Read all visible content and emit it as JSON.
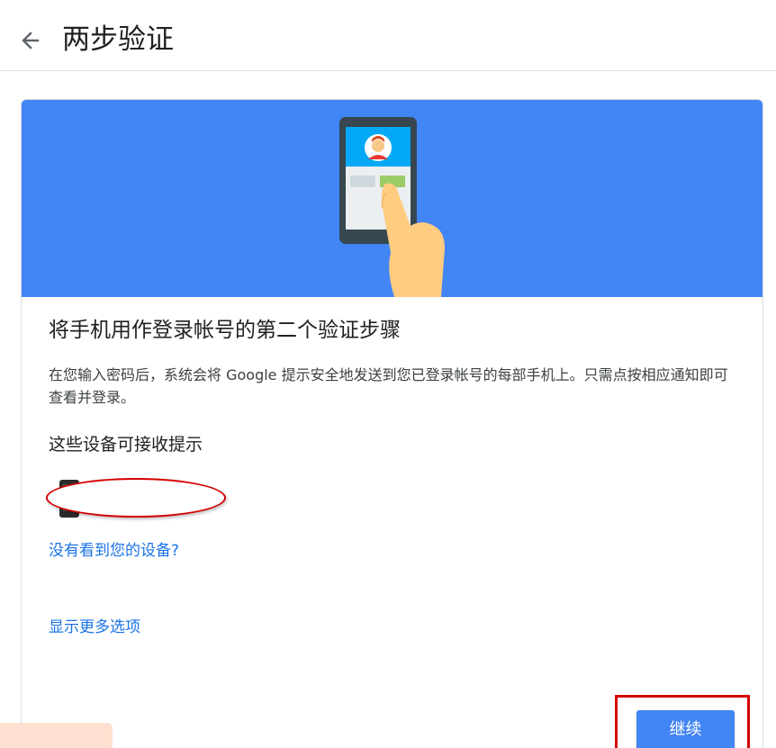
{
  "header": {
    "back_icon": "arrow-left-icon",
    "title": "两步验证"
  },
  "hero": {
    "illustration": "phone-with-hand-illustration",
    "background_color": "#4285f4"
  },
  "main": {
    "heading": "将手机用作登录帐号的第二个验证步骤",
    "description": "在您输入密码后，系统会将 Google 提示安全地发送到您已登录帐号的每部手机上。只需点按相应通知即可查看并登录。",
    "devices_heading": "这些设备可接收提示",
    "device_icon": "phone-icon",
    "link_no_device": "没有看到您的设备?",
    "link_more_options": "显示更多选项"
  },
  "footer": {
    "continue_label": "继续",
    "accent_color": "#4285f4",
    "highlight_color": "#d50000"
  }
}
